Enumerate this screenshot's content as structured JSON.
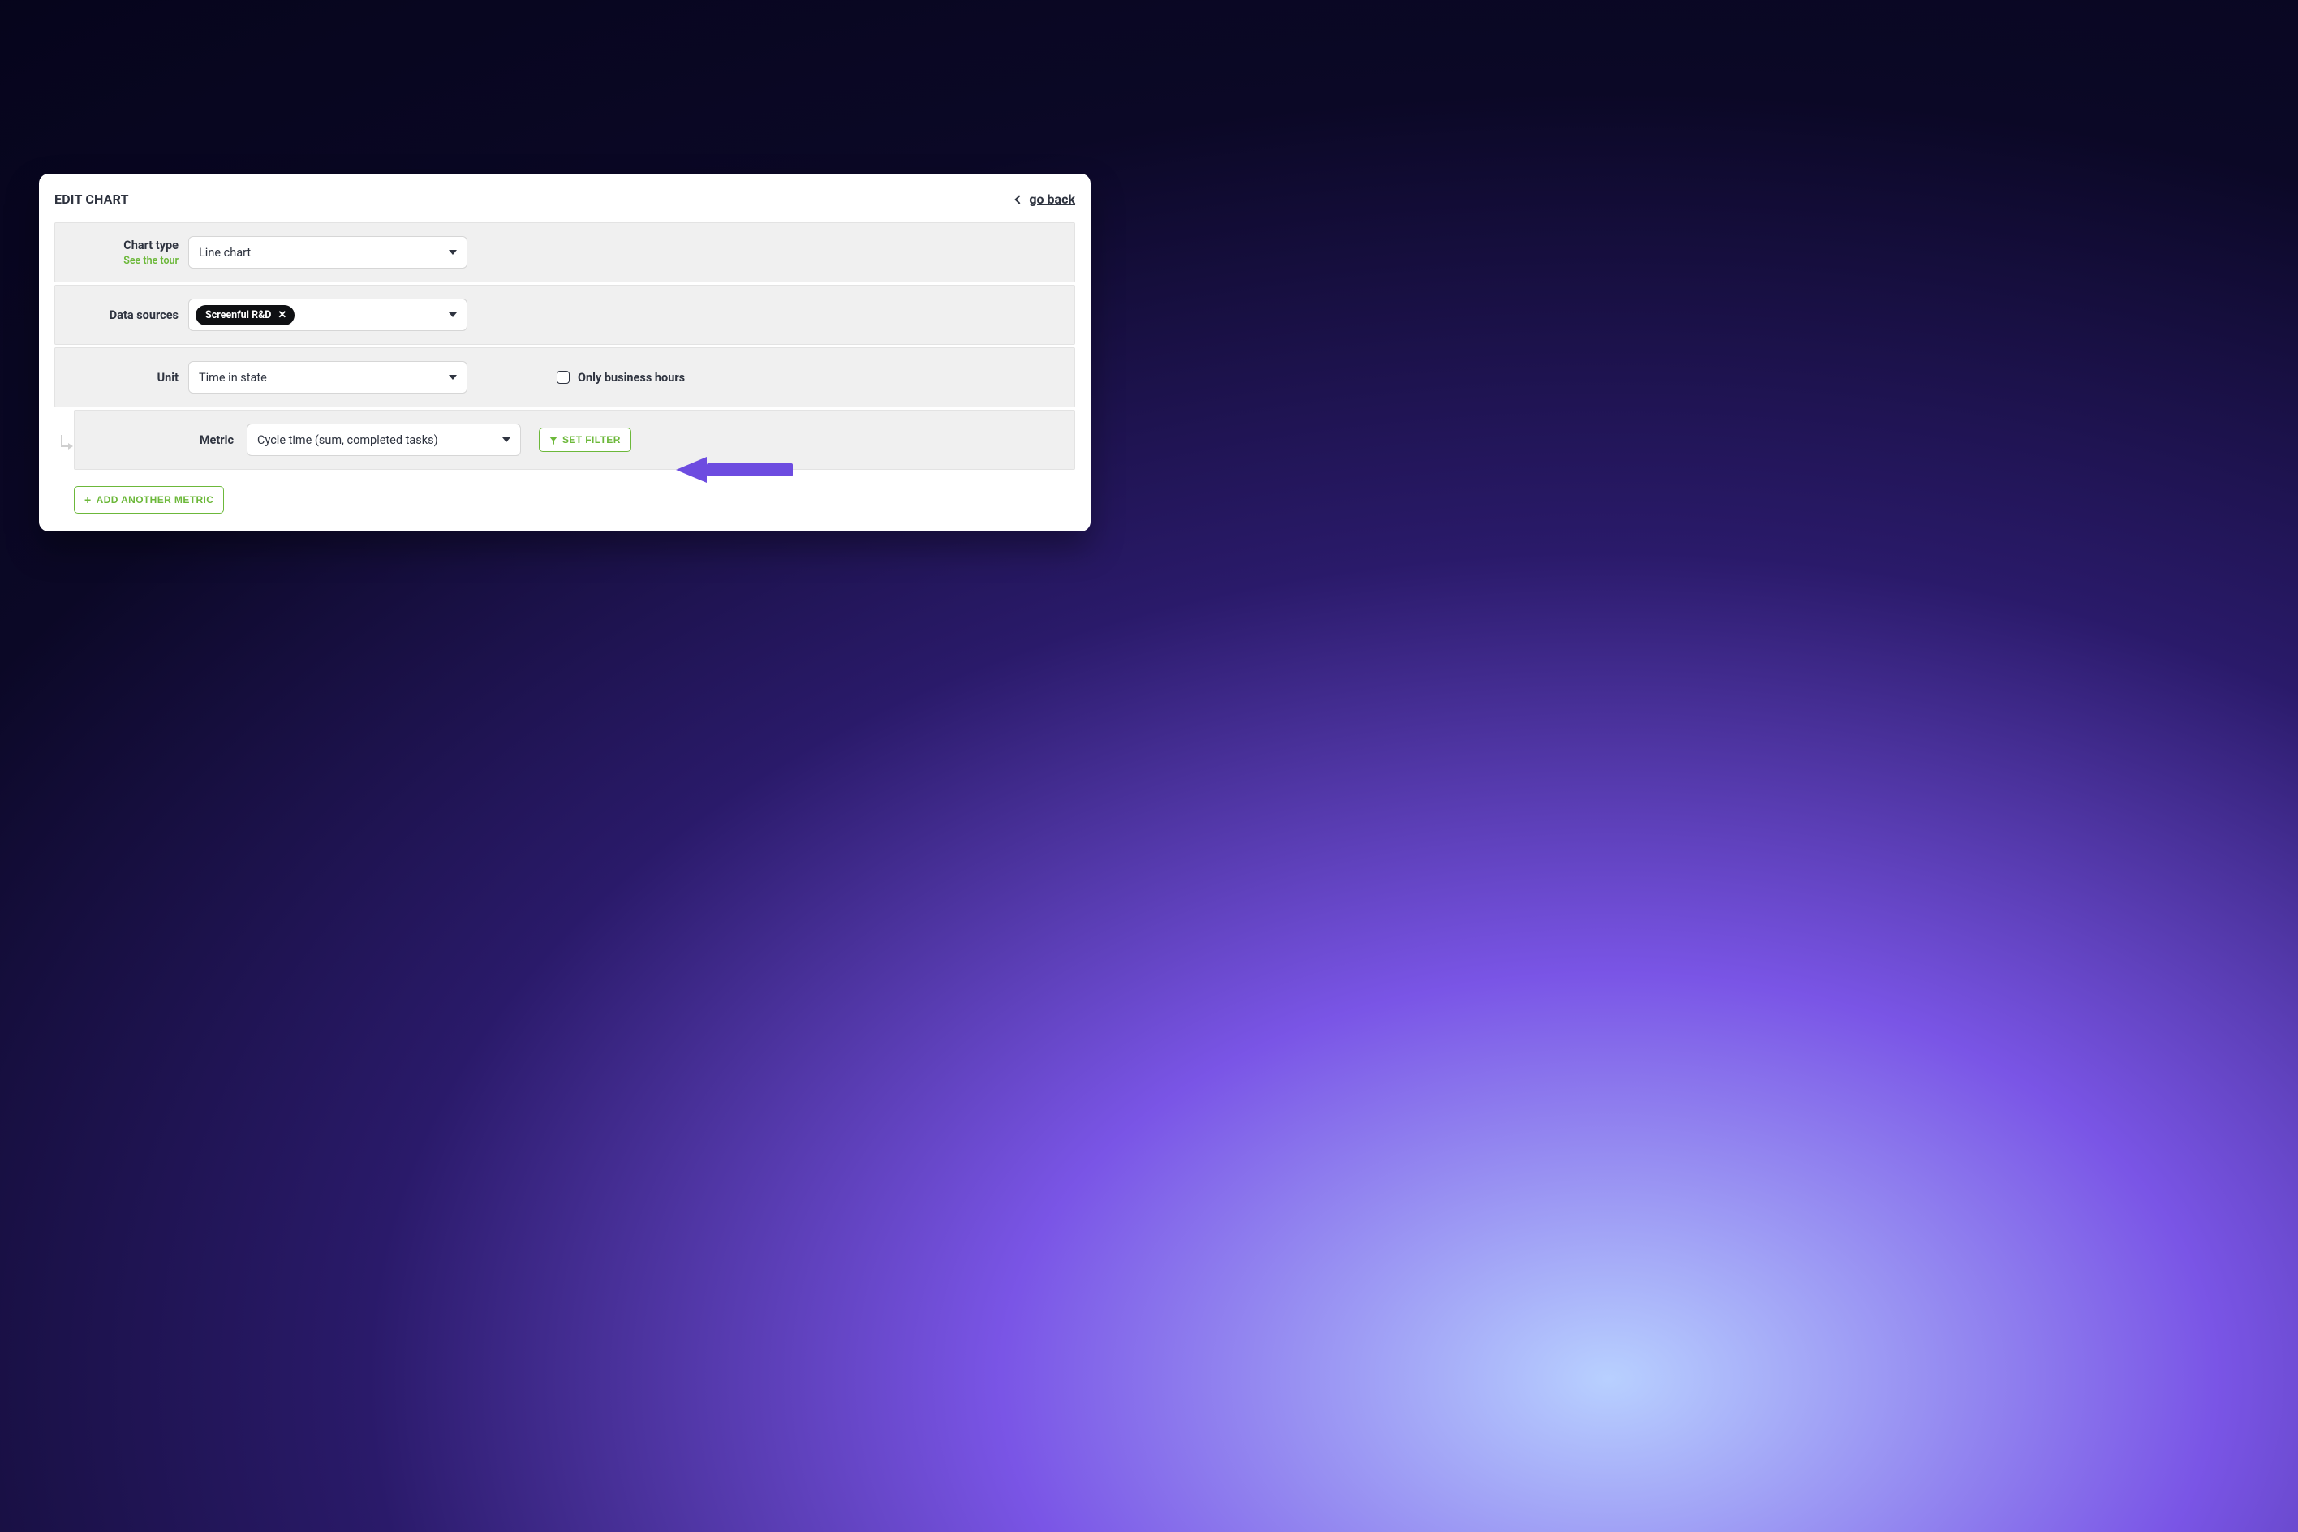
{
  "header": {
    "title": "EDIT CHART",
    "back_label": "go back"
  },
  "chart_type": {
    "label": "Chart type",
    "tour_link": "See the tour",
    "value": "Line chart"
  },
  "data_sources": {
    "label": "Data sources",
    "chip": "Screenful R&D"
  },
  "unit": {
    "label": "Unit",
    "value": "Time in state",
    "checkbox_label": "Only business hours"
  },
  "metric": {
    "label": "Metric",
    "value": "Cycle time (sum, completed tasks)",
    "set_filter_label": "Set Filter"
  },
  "add_metric": {
    "label": "Add Another Metric"
  }
}
